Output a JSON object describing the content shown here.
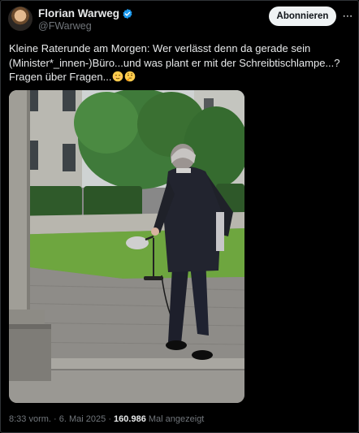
{
  "author": {
    "display_name": "Florian Warweg",
    "handle": "@FWarweg",
    "verified": true,
    "verified_color": "#1d9bf0"
  },
  "follow_button": {
    "label": "Abonnieren"
  },
  "more_icon": "more-horizontal-icon",
  "tweet": {
    "text": "Kleine Raterunde am Morgen: Wer verlässt denn da gerade sein (Minister*_innen-)Büro...und was plant er mit der Schreibtischlampe...? Fragen über Fragen...",
    "emojis": [
      "relieved-face-icon",
      "thinking-face-icon"
    ]
  },
  "meta": {
    "time": "8:33 vorm.",
    "separator": "·",
    "date": "6. Mai 2025",
    "views_count": "160.986",
    "views_label": "Mal angezeigt"
  }
}
